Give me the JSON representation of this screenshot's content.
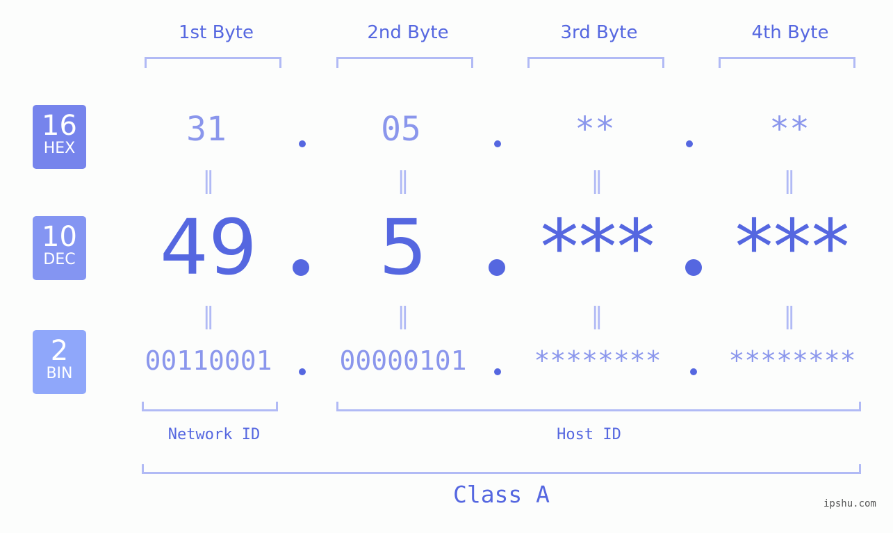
{
  "headers": [
    "1st Byte",
    "2nd Byte",
    "3rd Byte",
    "4th Byte"
  ],
  "badges": {
    "hex": {
      "num": "16",
      "label": "HEX",
      "color": "#7684ec"
    },
    "dec": {
      "num": "10",
      "label": "DEC",
      "color": "#8495f2"
    },
    "bin": {
      "num": "2",
      "label": "BIN",
      "color": "#8fa7fa"
    }
  },
  "hex": [
    "31",
    "05",
    "**",
    "**"
  ],
  "dec": [
    "49",
    "5",
    "***",
    "***"
  ],
  "bin": [
    "00110001",
    "00000101",
    "********",
    "********"
  ],
  "equals_sign": "=",
  "network_id_label": "Network ID",
  "host_id_label": "Host ID",
  "class_label": "Class A",
  "watermark": "ipshu.com",
  "colors": {
    "accent": "#5567e0",
    "light": "#8a96ec",
    "bracket": "#b1baf5"
  }
}
